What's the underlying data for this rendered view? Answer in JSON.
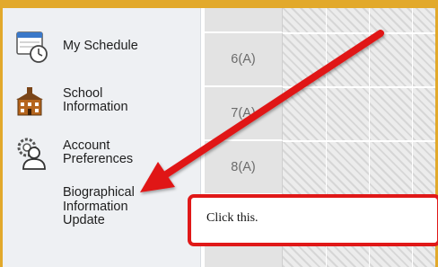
{
  "sidebar": {
    "items": [
      {
        "label": "My Schedule",
        "icon": "calendar-clock-icon"
      },
      {
        "label": "School\nInformation",
        "icon": "school-building-icon"
      },
      {
        "label": "Account\nPreferences",
        "icon": "user-gear-icon"
      }
    ],
    "sub_items": [
      {
        "label": "Biographical\nInformation\nUpdate"
      }
    ]
  },
  "schedule": {
    "periods": [
      "6(A)",
      "7(A)",
      "8(A)"
    ]
  },
  "callout": {
    "text": "Click this.",
    "color": "#e01818"
  },
  "colors": {
    "border": "#e2a92b",
    "sidebar_bg": "#eef0f3",
    "row_label_bg": "#e3e3e3"
  }
}
